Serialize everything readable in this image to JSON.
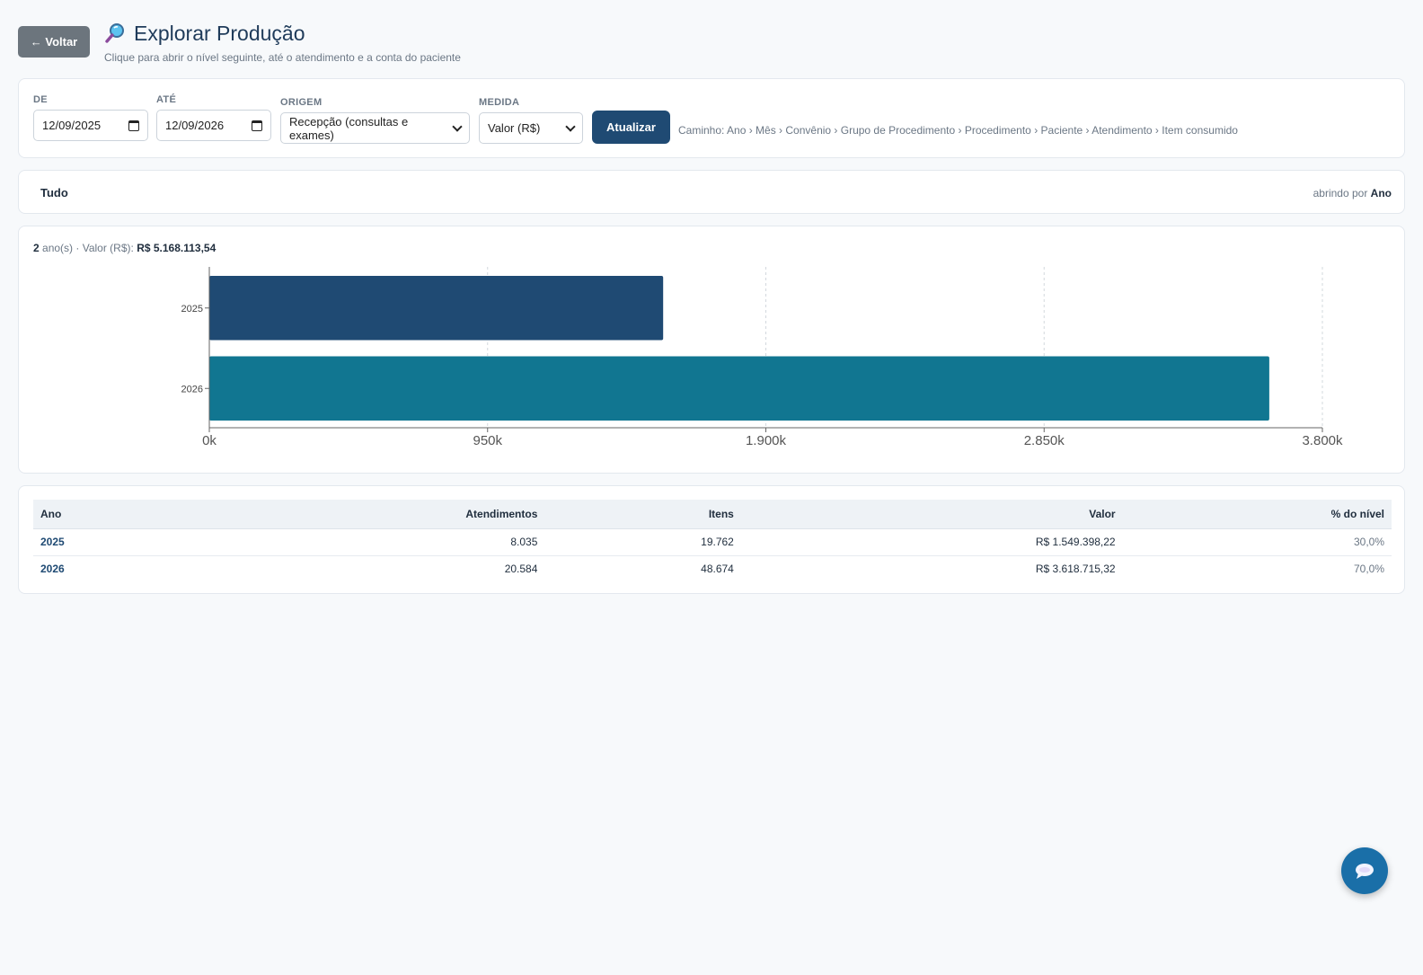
{
  "header": {
    "back_label": "← Voltar",
    "title": "Explorar Produção",
    "subtitle": "Clique para abrir o nível seguinte, até o atendimento e a conta do paciente",
    "title_icon": "magnifier-icon"
  },
  "filters": {
    "from_label": "DE",
    "from_value": "12/09/2025",
    "to_label": "ATÉ",
    "to_value": "12/09/2026",
    "origin_label": "ORIGEM",
    "origin_value": "Recepção (consultas e exames)",
    "measure_label": "MEDIDA",
    "measure_value": "Valor (R$)",
    "update_label": "Atualizar",
    "path_text": "Caminho: Ano › Mês › Convênio › Grupo de Procedimento › Procedimento › Paciente › Atendimento › Item consumido"
  },
  "breadcrumb": {
    "root": "Tudo",
    "drill_prefix": "abrindo por",
    "drill_level": "Ano"
  },
  "summary": {
    "count": "2",
    "count_unit": "ano(s)",
    "measure_prefix": "· Valor (R$):",
    "total": "R$ 5.168.113,54"
  },
  "chart_data": {
    "type": "bar",
    "orientation": "horizontal",
    "categories": [
      "2025",
      "2026"
    ],
    "values": [
      1549398.22,
      3618715.32
    ],
    "colors": [
      "#1f4a73",
      "#117691"
    ],
    "xlim": [
      0,
      3800000
    ],
    "xticks": [
      0,
      950000,
      1900000,
      2850000,
      3800000
    ],
    "xtick_labels": [
      "0k",
      "950k",
      "1.900k",
      "2.850k",
      "3.800k"
    ],
    "grid": "vertical-dashed",
    "title": "",
    "xlabel": "",
    "ylabel": ""
  },
  "table": {
    "columns": [
      "Ano",
      "Atendimentos",
      "Itens",
      "Valor",
      "% do nível"
    ],
    "rows": [
      {
        "ano": "2025",
        "atendimentos": "8.035",
        "itens": "19.762",
        "valor": "R$ 1.549.398,22",
        "pct": "30,0%"
      },
      {
        "ano": "2026",
        "atendimentos": "20.584",
        "itens": "48.674",
        "valor": "R$ 3.618.715,32",
        "pct": "70,0%"
      }
    ]
  },
  "chat": {
    "icon": "chat-bubble-icon",
    "color": "#1a6fa8"
  },
  "colors": {
    "accent": "#1f4a73",
    "secondary": "#117691",
    "background": "#f7f9fb"
  }
}
